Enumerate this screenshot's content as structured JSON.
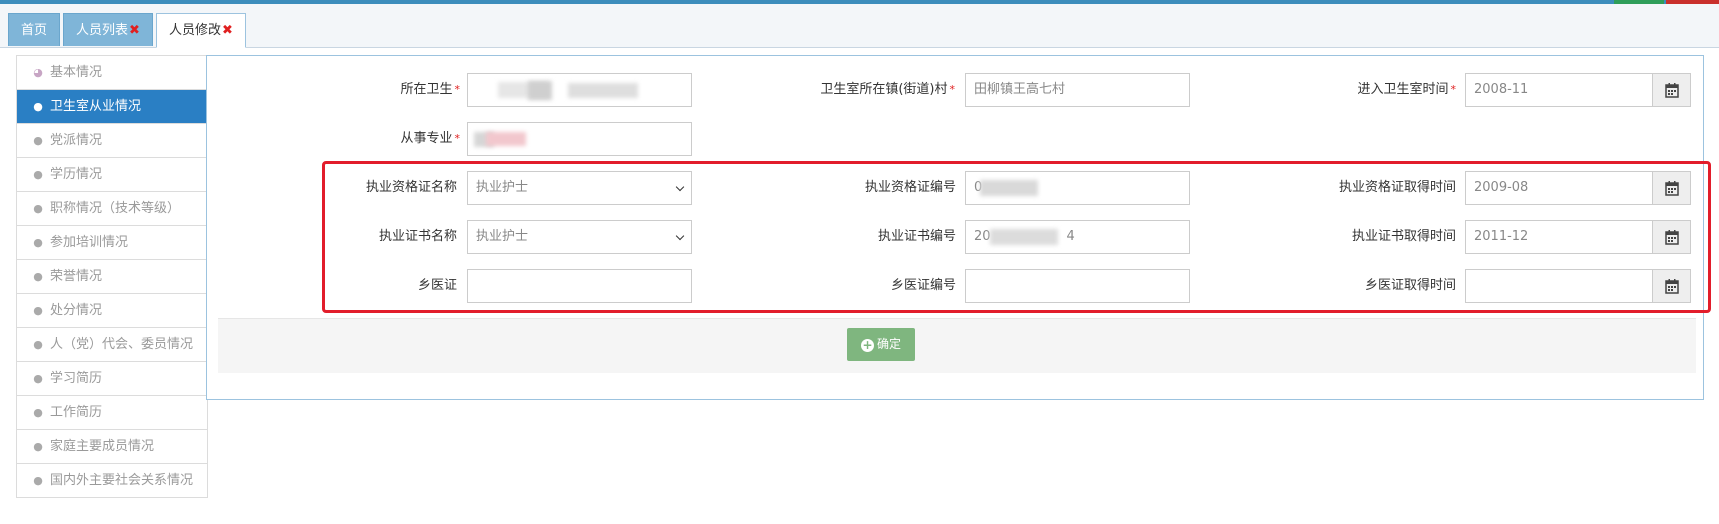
{
  "tabs": [
    {
      "label": "首页",
      "closable": false
    },
    {
      "label": "人员列表",
      "closable": true
    },
    {
      "label": "人员修改",
      "closable": true,
      "active": true
    }
  ],
  "tab_close_glyph": "✖",
  "sidebar": {
    "items": [
      {
        "label": "基本情况",
        "icon": "dashboard-icon"
      },
      {
        "label": "卫生室从业情况",
        "icon": "user-icon",
        "active": true
      },
      {
        "label": "党派情况",
        "icon": "user-icon"
      },
      {
        "label": "学历情况",
        "icon": "user-icon"
      },
      {
        "label": "职称情况（技术等级）",
        "icon": "user-icon"
      },
      {
        "label": "参加培训情况",
        "icon": "user-icon"
      },
      {
        "label": "荣誉情况",
        "icon": "user-icon"
      },
      {
        "label": "处分情况",
        "icon": "user-icon"
      },
      {
        "label": "人（党）代会、委员情况",
        "icon": "user-icon"
      },
      {
        "label": "学习简历",
        "icon": "user-icon"
      },
      {
        "label": "工作简历",
        "icon": "user-icon"
      },
      {
        "label": "家庭主要成员情况",
        "icon": "user-icon"
      },
      {
        "label": "国内外主要社会关系情况",
        "icon": "user-icon"
      }
    ]
  },
  "form": {
    "clinic_name": {
      "label": "所在卫生",
      "required": true
    },
    "clinic_town": {
      "label": "卫生室所在镇(街道)村",
      "required": true,
      "value": "田柳镇王高七村"
    },
    "enter_time": {
      "label": "进入卫生室时间",
      "required": true,
      "value": "2008-11"
    },
    "specialty": {
      "label": "从事专业",
      "required": true
    },
    "qual_cert_name": {
      "label": "执业资格证名称",
      "value": "执业护士"
    },
    "qual_cert_no": {
      "label": "执业资格证编号",
      "value": "0"
    },
    "qual_cert_time": {
      "label": "执业资格证取得时间",
      "value": "2009-08"
    },
    "prac_cert_name": {
      "label": "执业证书名称",
      "value": "执业护士"
    },
    "prac_cert_no": {
      "label": "执业证书编号",
      "value": "20",
      "value_tail": "4"
    },
    "prac_cert_time": {
      "label": "执业证书取得时间",
      "value": "2011-12"
    },
    "village_cert": {
      "label": "乡医证",
      "value": ""
    },
    "village_cert_no": {
      "label": "乡医证编号",
      "value": ""
    },
    "village_cert_time": {
      "label": "乡医证取得时间",
      "value": ""
    },
    "required_mark": "*"
  },
  "confirm_label": "确定",
  "colors": {
    "accent": "#2a7fc4",
    "highlight_box": "#e21d2b",
    "confirm": "#7fb67f",
    "tab": "#7fb5d8"
  }
}
